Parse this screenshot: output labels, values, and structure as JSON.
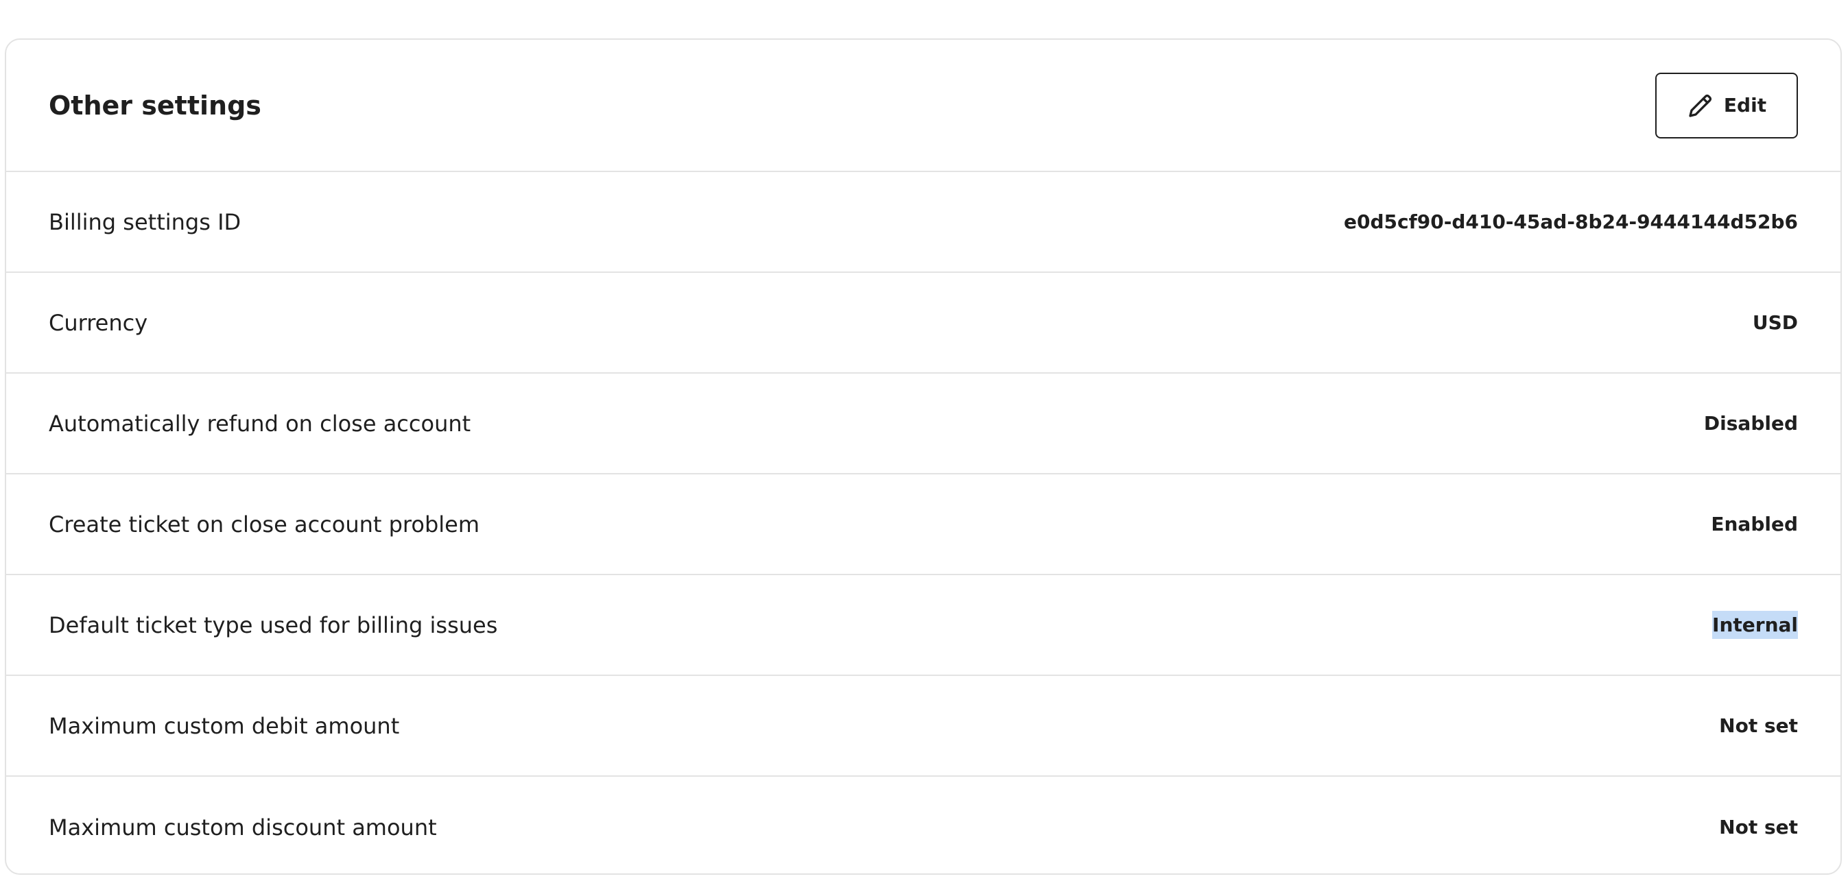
{
  "card": {
    "title": "Other settings",
    "edit_label": "Edit"
  },
  "settings": [
    {
      "label": "Billing settings ID",
      "value": "e0d5cf90-d410-45ad-8b24-9444144d52b6"
    },
    {
      "label": "Currency",
      "value": "USD"
    },
    {
      "label": "Automatically refund on close account",
      "value": "Disabled"
    },
    {
      "label": "Create ticket on close account problem",
      "value": "Enabled"
    },
    {
      "label": "Default ticket type used for billing issues",
      "value": "Internal"
    },
    {
      "label": "Maximum custom debit amount",
      "value": "Not set"
    },
    {
      "label": "Maximum custom discount amount",
      "value": "Not set"
    }
  ],
  "colors": {
    "text": "#1f1f1f",
    "border": "#e3e3e3",
    "selection_highlight": "#c5dcf7"
  },
  "icons": {
    "edit": "pencil-icon"
  }
}
